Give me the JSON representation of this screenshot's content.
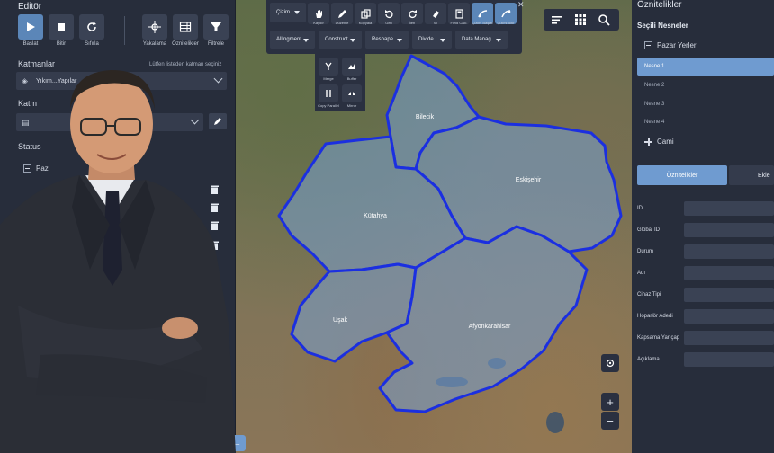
{
  "left_panel": {
    "title": "Editör",
    "tools": [
      {
        "label": "Başlat",
        "icon": "play-icon"
      },
      {
        "label": "Bitir",
        "icon": "stop-icon"
      },
      {
        "label": "Sıfırla",
        "icon": "reset-icon"
      },
      {
        "label": "Yakalama",
        "icon": "snap-icon"
      },
      {
        "label": "Öznitelikler",
        "icon": "table-icon"
      },
      {
        "label": "Filtrele",
        "icon": "filter-icon"
      }
    ],
    "layers_label": "Katmanlar",
    "layers_hint": "Lütfen listeden katman seçiniz",
    "layer_select_value": "Yıkım...Yapılar",
    "second_label": "Katm",
    "status_label": "Status",
    "tree_node": "Paz"
  },
  "map": {
    "toolbar_buttons": [
      "Çizim",
      "Kaydır",
      "Düzenle",
      "Kopyala",
      "Geri",
      "İleri",
      "Sil",
      "Field Calc.",
      "Çizimi Başlat",
      "Çizimi Bitir"
    ],
    "dropdowns": [
      "Allingment",
      "Construct",
      "Reshape",
      "Divide",
      "Data Manag..."
    ],
    "sub_tools": [
      "Merge",
      "Buffer",
      "Copy Parallel",
      "Mirror"
    ],
    "regions": [
      "Bilecik",
      "Eskişehir",
      "Kütahya",
      "Uşak",
      "Afyonkarahisar"
    ],
    "region_color": "#1b2fe0"
  },
  "right_panel": {
    "title": "Öznitelikler",
    "selected_header": "Seçili Nesneler",
    "groups": [
      {
        "name": "Pazar Yerleri",
        "expanded": true,
        "items": [
          "Nesne 1",
          "Nesne 2",
          "Nesne 3",
          "Nesne 4"
        ],
        "selected": "Nesne 1"
      },
      {
        "name": "Cami",
        "expanded": false,
        "items": []
      }
    ],
    "tabs": [
      "Öznitelikler",
      "Ekle"
    ],
    "attributes": [
      "ID",
      "Global ID",
      "Durum",
      "Adı",
      "Cihaz Tipi",
      "Hoparlör Adedi",
      "Kapsama Yarıçap",
      "Açıklama"
    ]
  }
}
